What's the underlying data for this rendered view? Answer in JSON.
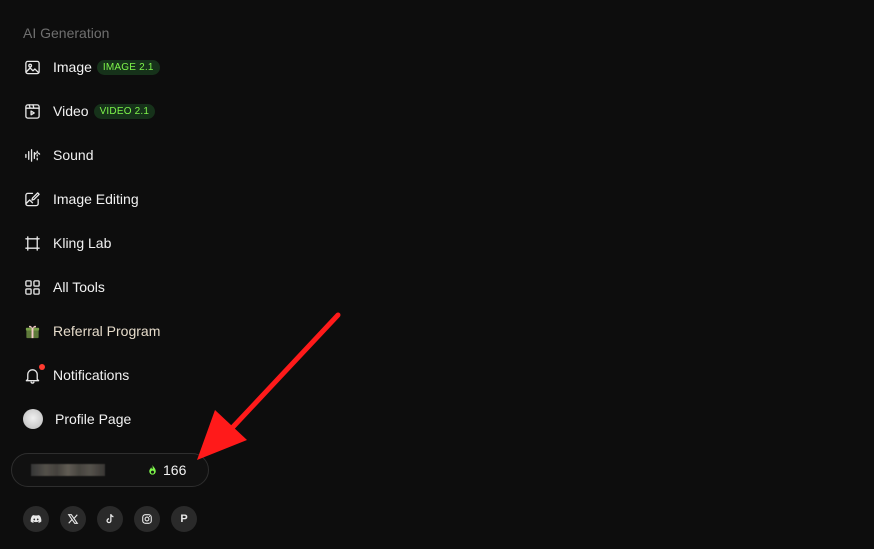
{
  "sidebar": {
    "section_title": "AI Generation",
    "items": [
      {
        "label": "Image",
        "badge": "IMAGE 2.1",
        "icon": "image-icon"
      },
      {
        "label": "Video",
        "badge": "VIDEO 2.1",
        "icon": "video-icon"
      },
      {
        "label": "Sound",
        "icon": "sound-icon"
      },
      {
        "label": "Image Editing",
        "icon": "image-edit-icon"
      },
      {
        "label": "Kling Lab",
        "icon": "lab-icon"
      },
      {
        "label": "All Tools",
        "icon": "grid-icon"
      },
      {
        "label": "Referral Program",
        "icon": "gift-icon"
      },
      {
        "label": "Notifications",
        "icon": "bell-icon"
      },
      {
        "label": "Profile Page",
        "icon": "avatar"
      }
    ]
  },
  "account": {
    "credits": "166"
  },
  "socials": [
    {
      "name": "discord-icon"
    },
    {
      "name": "x-icon"
    },
    {
      "name": "tiktok-icon"
    },
    {
      "name": "instagram-icon"
    },
    {
      "name": "p-icon",
      "letter": "P"
    }
  ],
  "colors": {
    "background": "#0d0d0d",
    "badge_text": "#7ef54b",
    "badge_bg": "#16321a",
    "credit_icon": "#7ef54b",
    "notification_dot": "#ff3b30",
    "arrow": "#ff1a1a"
  }
}
